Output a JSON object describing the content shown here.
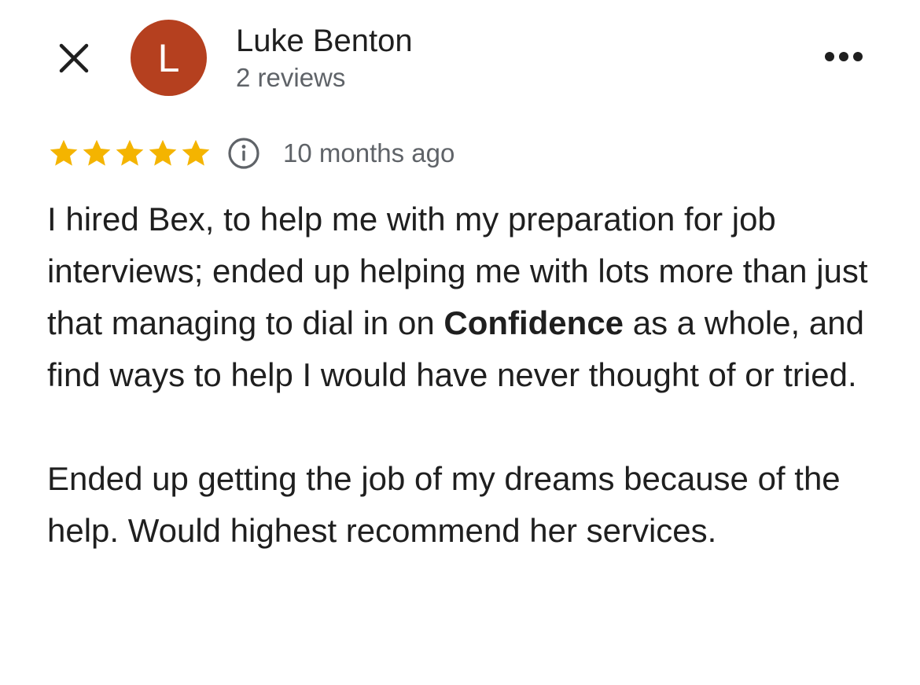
{
  "header": {
    "close_icon": "close-icon",
    "more_icon": "more-horizontal-icon"
  },
  "author": {
    "avatar_letter": "L",
    "avatar_color": "#b5401f",
    "name": "Luke Benton",
    "reviews_count": "2 reviews"
  },
  "rating": {
    "stars": 5,
    "max_stars": 5,
    "star_color": "#f4b400",
    "info_icon": "info-icon",
    "time_ago": "10 months ago"
  },
  "review": {
    "p1_part1": "I hired Bex, to help me with my preparation for job interviews; ended up helping me with lots more than just that managing to dial in on ",
    "p1_bold": "Confidence",
    "p1_part2": " as a whole, and find ways to help I would have never thought of or tried.",
    "p2": "Ended up getting the job of my dreams because of the help. Would highest recommend her services."
  }
}
